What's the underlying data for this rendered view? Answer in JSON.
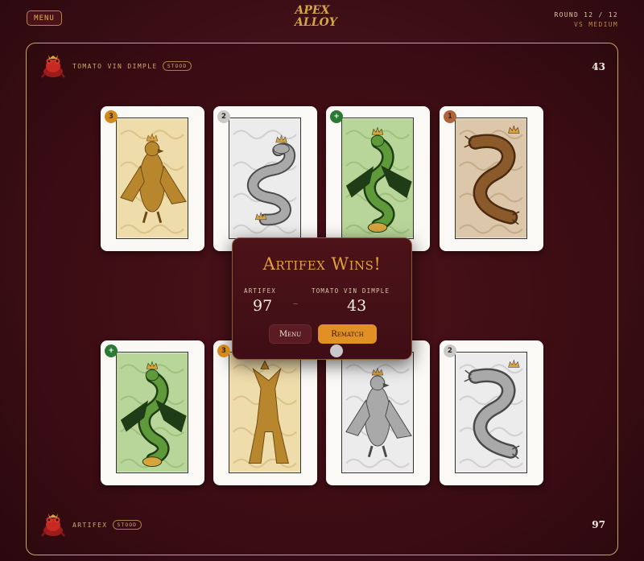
{
  "topbar": {
    "menu_label": "MENU",
    "logo_line1": "APEX",
    "logo_line2": "ALLOY",
    "round_text": "ROUND 12 / 12",
    "opponent_text": "VS MEDIUM"
  },
  "opponent": {
    "name": "TOMATO VIN DIMPLE",
    "status": "STOOD",
    "score": "43",
    "cards": [
      {
        "pip": "3",
        "pip_color": "#d28a1c",
        "creature": "eagle",
        "material": "gold"
      },
      {
        "pip": "2",
        "pip_color": "#c9c9c9",
        "creature": "serpent",
        "material": "silver"
      },
      {
        "pip": "+",
        "pip_color": "#2a7a36",
        "creature": "dragon",
        "material": "green"
      },
      {
        "pip": "1",
        "pip_color": "#b0643a",
        "creature": "catfish",
        "material": "bronze"
      }
    ]
  },
  "player": {
    "name": "ARTIFEX",
    "status": "STOOD",
    "score": "97",
    "cards": [
      {
        "pip": "+",
        "pip_color": "#2a7a36",
        "creature": "dragon",
        "material": "green"
      },
      {
        "pip": "3",
        "pip_color": "#d28a1c",
        "creature": "wolf",
        "material": "gold"
      },
      {
        "pip": "",
        "pip_color": "#c9c9c9",
        "creature": "eagle",
        "material": "silver"
      },
      {
        "pip": "2",
        "pip_color": "#c9c9c9",
        "creature": "catfish",
        "material": "silver"
      }
    ]
  },
  "result": {
    "title": "Artifex Wins!",
    "p1_label": "ARTIFEX",
    "p1_score": "97",
    "separator": "–",
    "p2_label": "TOMATO VIN DIMPLE",
    "p2_score": "43",
    "menu_button": "Menu",
    "rematch_button": "Rematch"
  },
  "colors": {
    "accent": "#e09024",
    "board_border": "#c9a66b",
    "background": "#3d0f16"
  }
}
